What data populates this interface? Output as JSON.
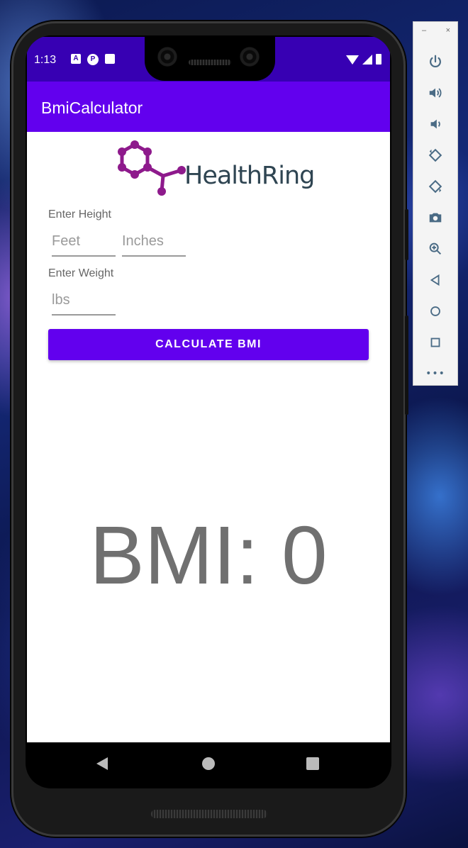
{
  "status_bar": {
    "time": "1:13",
    "icons": [
      "font-a-icon",
      "p-icon",
      "sd-card-icon",
      "wifi-icon",
      "signal-icon",
      "battery-icon"
    ]
  },
  "app": {
    "title": "BmiCalculator",
    "logo_text": "HealthRing",
    "height_label": "Enter Height",
    "feet_placeholder": "Feet",
    "inches_placeholder": "Inches",
    "weight_label": "Enter Weight",
    "lbs_placeholder": "lbs",
    "calculate_button": "CALCULATE BMI",
    "result": "BMI: 0"
  },
  "colors": {
    "status_bar": "#3700b3",
    "app_bar": "#6200ee",
    "button": "#6200ee",
    "logo_purple": "#8e1a8c",
    "logo_text": "#2f4552"
  },
  "nav_bar": [
    "back-icon",
    "home-icon",
    "recents-icon"
  ],
  "emulator_toolbar": {
    "window_buttons": [
      "–",
      "×"
    ],
    "tools": [
      "power-icon",
      "volume-up-icon",
      "volume-down-icon",
      "rotate-left-icon",
      "rotate-right-icon",
      "camera-icon",
      "zoom-icon",
      "back-icon",
      "home-icon",
      "overview-icon",
      "more-icon"
    ],
    "more": "•••"
  }
}
